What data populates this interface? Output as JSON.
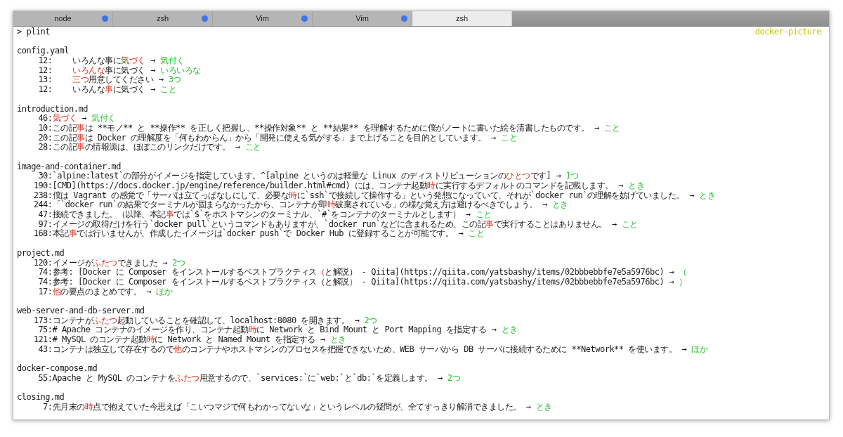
{
  "tabs": [
    {
      "label": "node",
      "selected": false,
      "activity": true
    },
    {
      "label": "zsh",
      "selected": false,
      "activity": true
    },
    {
      "label": "Vim",
      "selected": false,
      "activity": true
    },
    {
      "label": "Vim",
      "selected": false,
      "activity": true
    },
    {
      "label": "zsh",
      "selected": true,
      "activity": false
    }
  ],
  "terminal": {
    "command": "> plint",
    "directory": "docker-picture",
    "files": [
      {
        "name": "config.yaml",
        "kind": "yaml",
        "results": [
          {
            "line": "12:",
            "before": "いろんな事に",
            "match": "気づく",
            "arrow": "→",
            "suggestion": "気付く"
          },
          {
            "line": "12:",
            "match": "いろんな",
            "after": "事に気づく",
            "arrow": "→",
            "suggestion": "いろいろな"
          },
          {
            "line": "13:",
            "match": "三つ",
            "after": "用意してください",
            "arrow": "→",
            "suggestion": "3つ"
          },
          {
            "line": "12:",
            "before": "いろんな",
            "match": "事",
            "after": "に気づく",
            "arrow": "→",
            "suggestion": "こと"
          }
        ]
      },
      {
        "name": "introduction.md",
        "kind": "markdown",
        "results": [
          {
            "line": "46:",
            "match": "気づく",
            "arrow": "→",
            "suggestion": "気付く"
          },
          {
            "line": "10:",
            "before": "この記",
            "match": "事",
            "after": "は **モノ** と **操作** を正しく把握し、**操作対象** と **結果** を理解するために僕がノートに書いた絵を清書したものです。",
            "arrow": "→",
            "suggestion": "こと"
          },
          {
            "line": "20:",
            "before": "この記",
            "match": "事",
            "after": "は Docker の理解度を「何もわからん」から「開発に使える気がする」まで上げることを目的としています。",
            "arrow": "→",
            "suggestion": "こと"
          },
          {
            "line": "28:",
            "before": "この記",
            "match": "事",
            "after": "の情報源は、ほぼこのリンクだけです。",
            "arrow": "→",
            "suggestion": "こと"
          }
        ]
      },
      {
        "name": "image-and-container.md",
        "kind": "markdown",
        "results": [
          {
            "line": "30:",
            "before": "`alpine:latest`の部分がイメージを指定しています。^[alpine というのは軽量な Linux のディストリビューションの",
            "match": "ひとつ",
            "after": "です]",
            "arrow": "→",
            "suggestion": "1つ"
          },
          {
            "line": "190:",
            "before": "[CMD](https://docs.docker.jp/engine/reference/builder.html#cmd) には、コンテナ起動",
            "match": "時",
            "after": "に実行するデフォルトのコマンドを記載します。",
            "arrow": "→",
            "suggestion": "とき"
          },
          {
            "line": "238:",
            "before": "僕は Vagrant の感覚で「サーバは立てっぱなしにして、必要な",
            "match": "時",
            "after": "に`ssh`で接続して操作する」という発想になっていて、それが`docker run`の理解を妨げていました。",
            "arrow": "→",
            "suggestion": "とき"
          },
          {
            "line": "244:",
            "before": "「`docker run`の結果でターミナルが固まらなかったから、コンテナが即",
            "match": "時",
            "after": "破棄されている」の様な覚え方は避けるべきでしょう。",
            "arrow": "→",
            "suggestion": "とき"
          },
          {
            "line": "47:",
            "before": "接続できました。（以降、本記",
            "match": "事",
            "after": "では`$`をホストマシンのターミナル、`#`をコンテナのターミナルとします）",
            "arrow": "→",
            "suggestion": "こと"
          },
          {
            "line": "97:",
            "before": "イメージの取得だけを行う`docker pull`というコマンドもありますが、`docker run`などに含まれるため、この記",
            "match": "事",
            "after": "で実行することはありません。",
            "arrow": "→",
            "suggestion": "こと"
          },
          {
            "line": "168:",
            "before": "本記",
            "match": "事",
            "after": "では行いませんが、作成したイメージは`docker push`で Docker Hub に登録することが可能です。",
            "arrow": "→",
            "suggestion": "こと"
          }
        ]
      },
      {
        "name": "project.md",
        "kind": "markdown",
        "results": [
          {
            "line": "120:",
            "before": "イメージが",
            "match": "ふたつ",
            "after": "できました",
            "arrow": "→",
            "suggestion": "2つ"
          },
          {
            "line": "74:",
            "before": "参考: [Docker に Composer をインストールするベストプラクティス",
            "match": "（",
            "after": "と解説） - Qiita](https://qiita.com/yatsbashy/items/02bbbebbfe7e5a5976bc)",
            "arrow": "→",
            "suggestion": "（"
          },
          {
            "line": "74:",
            "before": "参考: [Docker に Composer をインストールするベストプラクティス（と解説",
            "match": "）",
            "after": " - Qiita](https://qiita.com/yatsbashy/items/02bbbebbfe7e5a5976bc)",
            "arrow": "→",
            "suggestion": "）"
          },
          {
            "line": "17:",
            "match": "他",
            "after": "の要点のまとめです。",
            "arrow": "→",
            "suggestion": "ほか"
          }
        ]
      },
      {
        "name": "web-server-and-db-server.md",
        "kind": "markdown",
        "results": [
          {
            "line": "173:",
            "before": "コンテナが",
            "match": "ふたつ",
            "after": "起動していることを確認して、localhost:8080 を開きます。",
            "arrow": "→",
            "suggestion": "2つ"
          },
          {
            "line": "75:",
            "before": "# Apache コンテナのイメージを作り、コンテナ起動",
            "match": "時",
            "after": "に Network と Bind Mount と Port Mapping を指定する",
            "arrow": "→",
            "suggestion": "とき"
          },
          {
            "line": "121:",
            "before": "# MySQL のコンテナ起動",
            "match": "時",
            "after": "に Network と Named Mount を指定する",
            "arrow": "→",
            "suggestion": "とき"
          },
          {
            "line": "43:",
            "before": "コンテナは独立して存在するので",
            "match": "他",
            "after": "のコンテナやホストマシンのプロセスを把握できないため、WEB サーバから DB サーバに接続するために **Network** を使います。",
            "arrow": "→",
            "suggestion": "ほか"
          }
        ]
      },
      {
        "name": "docker-compose.md",
        "kind": "markdown",
        "results": [
          {
            "line": "55:",
            "before": "Apache と MySQL のコンテナを",
            "match": "ふたつ",
            "after": "用意するので、`services:`に`web:`と`db:`を定義します。",
            "arrow": "→",
            "suggestion": "2つ"
          }
        ]
      },
      {
        "name": "closing.md",
        "kind": "markdown",
        "results": [
          {
            "line": "7:",
            "before": "先月末の",
            "match": "時",
            "after": "点で抱えていた今思えば「こいつマジで何もわかってないな」というレベルの疑問が、全てすっきり解消できました。",
            "arrow": "→",
            "suggestion": "とき"
          }
        ]
      }
    ]
  }
}
